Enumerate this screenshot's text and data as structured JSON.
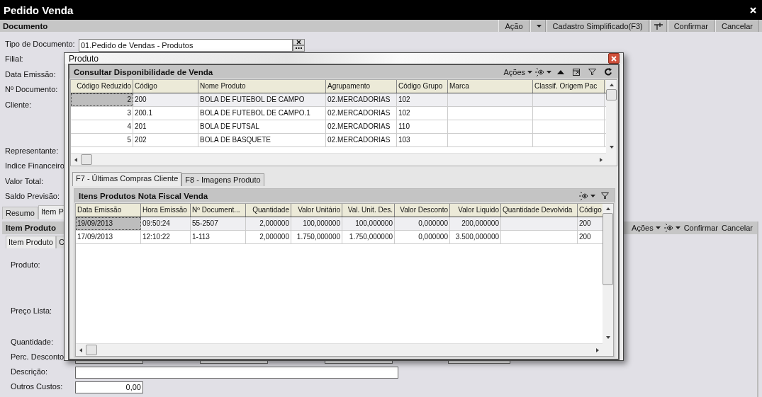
{
  "window": {
    "title": "Pedido Venda"
  },
  "document_bar": {
    "title": "Documento",
    "toolbar": [
      {
        "kind": "button",
        "label": "Ação"
      },
      {
        "kind": "dropdown"
      },
      {
        "kind": "button",
        "label": "Cadastro Simplificado(F3)"
      },
      {
        "kind": "pin"
      },
      {
        "kind": "button",
        "label": "Confirmar"
      },
      {
        "kind": "button",
        "label": "Cancelar"
      }
    ]
  },
  "form": {
    "fields": [
      {
        "kind": "lookup",
        "label": "Tipo de Documento:",
        "value": "01.Pedido de Vendas - Produtos"
      },
      {
        "kind": "plain",
        "label": "Filial:"
      },
      {
        "kind": "plain",
        "label": "Data Emissão:"
      },
      {
        "kind": "plain",
        "label": "Nº Documento:"
      },
      {
        "kind": "tall",
        "label": "Cliente:"
      },
      {
        "kind": "plain",
        "label": "Representante:"
      },
      {
        "kind": "plain",
        "label": "Indice Financeiro"
      },
      {
        "kind": "plain",
        "label": "Valor Total:"
      },
      {
        "kind": "plain",
        "label": "Saldo Previsão:"
      }
    ]
  },
  "tabs": [
    {
      "label": "Resumo",
      "selected": false
    },
    {
      "label": "Item P",
      "selected": true
    }
  ],
  "item_panel": {
    "title": "Item Produto",
    "toolbar": [
      {
        "kind": "menu",
        "label": "Ações"
      },
      {
        "kind": "eye"
      },
      {
        "kind": "button",
        "label": "Confirmar"
      },
      {
        "kind": "button",
        "label": "Cancelar"
      }
    ],
    "tabs": [
      {
        "label": "Item Produto",
        "selected": true
      },
      {
        "label": "C",
        "selected": false
      }
    ],
    "fields": [
      {
        "kind": "tall",
        "label": "Produto:"
      },
      {
        "kind": "medium",
        "label": "Preço Lista:"
      },
      {
        "kind": "plain",
        "label": "Quantidade:"
      },
      {
        "kind": "boxes",
        "label": "Perc. Desconto"
      },
      {
        "kind": "wide",
        "label": "Descrição:"
      },
      {
        "kind": "number",
        "label": "Outros Custos:",
        "value": "0,00"
      }
    ]
  },
  "dialog": {
    "title": "Produto",
    "availability": {
      "title": "Consultar Disponibilidade de Venda",
      "toolbar": [
        {
          "kind": "menu",
          "label": "Ações"
        },
        {
          "kind": "eye"
        },
        {
          "kind": "up"
        },
        {
          "kind": "window"
        },
        {
          "kind": "filter"
        },
        {
          "kind": "refresh"
        }
      ],
      "columns": [
        {
          "label": "Código Reduzido",
          "kind": "number"
        },
        {
          "label": "Código",
          "kind": "text"
        },
        {
          "label": "Nome Produto",
          "kind": "text"
        },
        {
          "label": "Agrupamento",
          "kind": "text"
        },
        {
          "label": "Código Grupo",
          "kind": "text"
        },
        {
          "label": "Marca",
          "kind": "text"
        },
        {
          "label": "Classif. Origem Pac",
          "kind": "text"
        }
      ],
      "rows": [
        {
          "selected": true,
          "cells": [
            "2",
            "200",
            "BOLA DE FUTEBOL DE CAMPO",
            "02.MERCADORIAS",
            "102",
            "",
            ""
          ]
        },
        {
          "selected": false,
          "cells": [
            "3",
            "200.1",
            "BOLA DE FUTEBOL DE CAMPO.1",
            "02.MERCADORIAS",
            "102",
            "",
            ""
          ]
        },
        {
          "selected": false,
          "cells": [
            "4",
            "201",
            "BOLA DE FUTSAL",
            "02.MERCADORIAS",
            "110",
            "",
            ""
          ]
        },
        {
          "selected": false,
          "cells": [
            "5",
            "202",
            "BOLA DE BASQUETE",
            "02.MERCADORIAS",
            "103",
            "",
            ""
          ]
        }
      ]
    },
    "tabs": [
      {
        "label": "F7 - Últimas Compras Cliente",
        "selected": true
      },
      {
        "label": "F8 - Imagens Produto",
        "selected": false
      }
    ],
    "invoice_items": {
      "title": "Itens Produtos Nota Fiscal Venda",
      "toolbar": [
        {
          "kind": "eye"
        },
        {
          "kind": "filter"
        }
      ],
      "columns": [
        {
          "label": "Data Emissão",
          "kind": "text"
        },
        {
          "label": "Hora Emissão",
          "kind": "text"
        },
        {
          "label": "Nº Document...",
          "kind": "text"
        },
        {
          "label": "Quantidade",
          "kind": "number"
        },
        {
          "label": "Valor Unitário",
          "kind": "number"
        },
        {
          "label": "Val. Unit. Des.",
          "kind": "number"
        },
        {
          "label": "Valor Desconto",
          "kind": "number"
        },
        {
          "label": "Valor Liquido",
          "kind": "number"
        },
        {
          "label": "Quantidade Devolvida",
          "kind": "text"
        },
        {
          "label": "Código",
          "kind": "text"
        }
      ],
      "rows": [
        {
          "selected": true,
          "cells": [
            "19/09/2013",
            "09:50:24",
            "55-2507",
            "2,000000",
            "100,000000",
            "100,000000",
            "0,000000",
            "200,000000",
            "",
            "200"
          ]
        },
        {
          "selected": false,
          "cells": [
            "17/09/2013",
            "12:10:22",
            "1-113",
            "2,000000",
            "1.750,000000",
            "1.750,000000",
            "0,000000",
            "3.500,000000",
            "",
            "200"
          ]
        }
      ]
    }
  }
}
